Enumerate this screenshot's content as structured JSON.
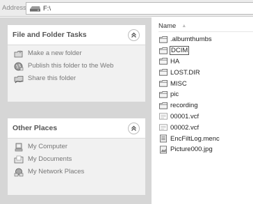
{
  "address": {
    "label": "Address",
    "path": "F:\\"
  },
  "panels": {
    "file_tasks": {
      "title": "File and Folder Tasks",
      "items": [
        {
          "label": "Make a new folder",
          "icon": "new-folder-icon"
        },
        {
          "label": "Publish this folder to the Web",
          "icon": "publish-web-icon"
        },
        {
          "label": "Share this folder",
          "icon": "share-folder-icon"
        }
      ]
    },
    "other_places": {
      "title": "Other Places",
      "items": [
        {
          "label": "My Computer",
          "icon": "my-computer-icon"
        },
        {
          "label": "My Documents",
          "icon": "my-documents-icon"
        },
        {
          "label": "My Network Places",
          "icon": "network-places-icon"
        }
      ]
    }
  },
  "file_list": {
    "column": "Name",
    "items": [
      {
        "name": ".albumthumbs",
        "type": "folder"
      },
      {
        "name": "DCIM",
        "type": "folder",
        "selected": true
      },
      {
        "name": "HA",
        "type": "folder"
      },
      {
        "name": "LOST.DIR",
        "type": "folder"
      },
      {
        "name": "MISC",
        "type": "folder"
      },
      {
        "name": "pic",
        "type": "folder"
      },
      {
        "name": "recording",
        "type": "folder"
      },
      {
        "name": "00001.vcf",
        "type": "vcf"
      },
      {
        "name": "00002.vcf",
        "type": "vcf"
      },
      {
        "name": "EncFiltLog.menc",
        "type": "doc"
      },
      {
        "name": "Picture000.jpg",
        "type": "image"
      }
    ]
  }
}
